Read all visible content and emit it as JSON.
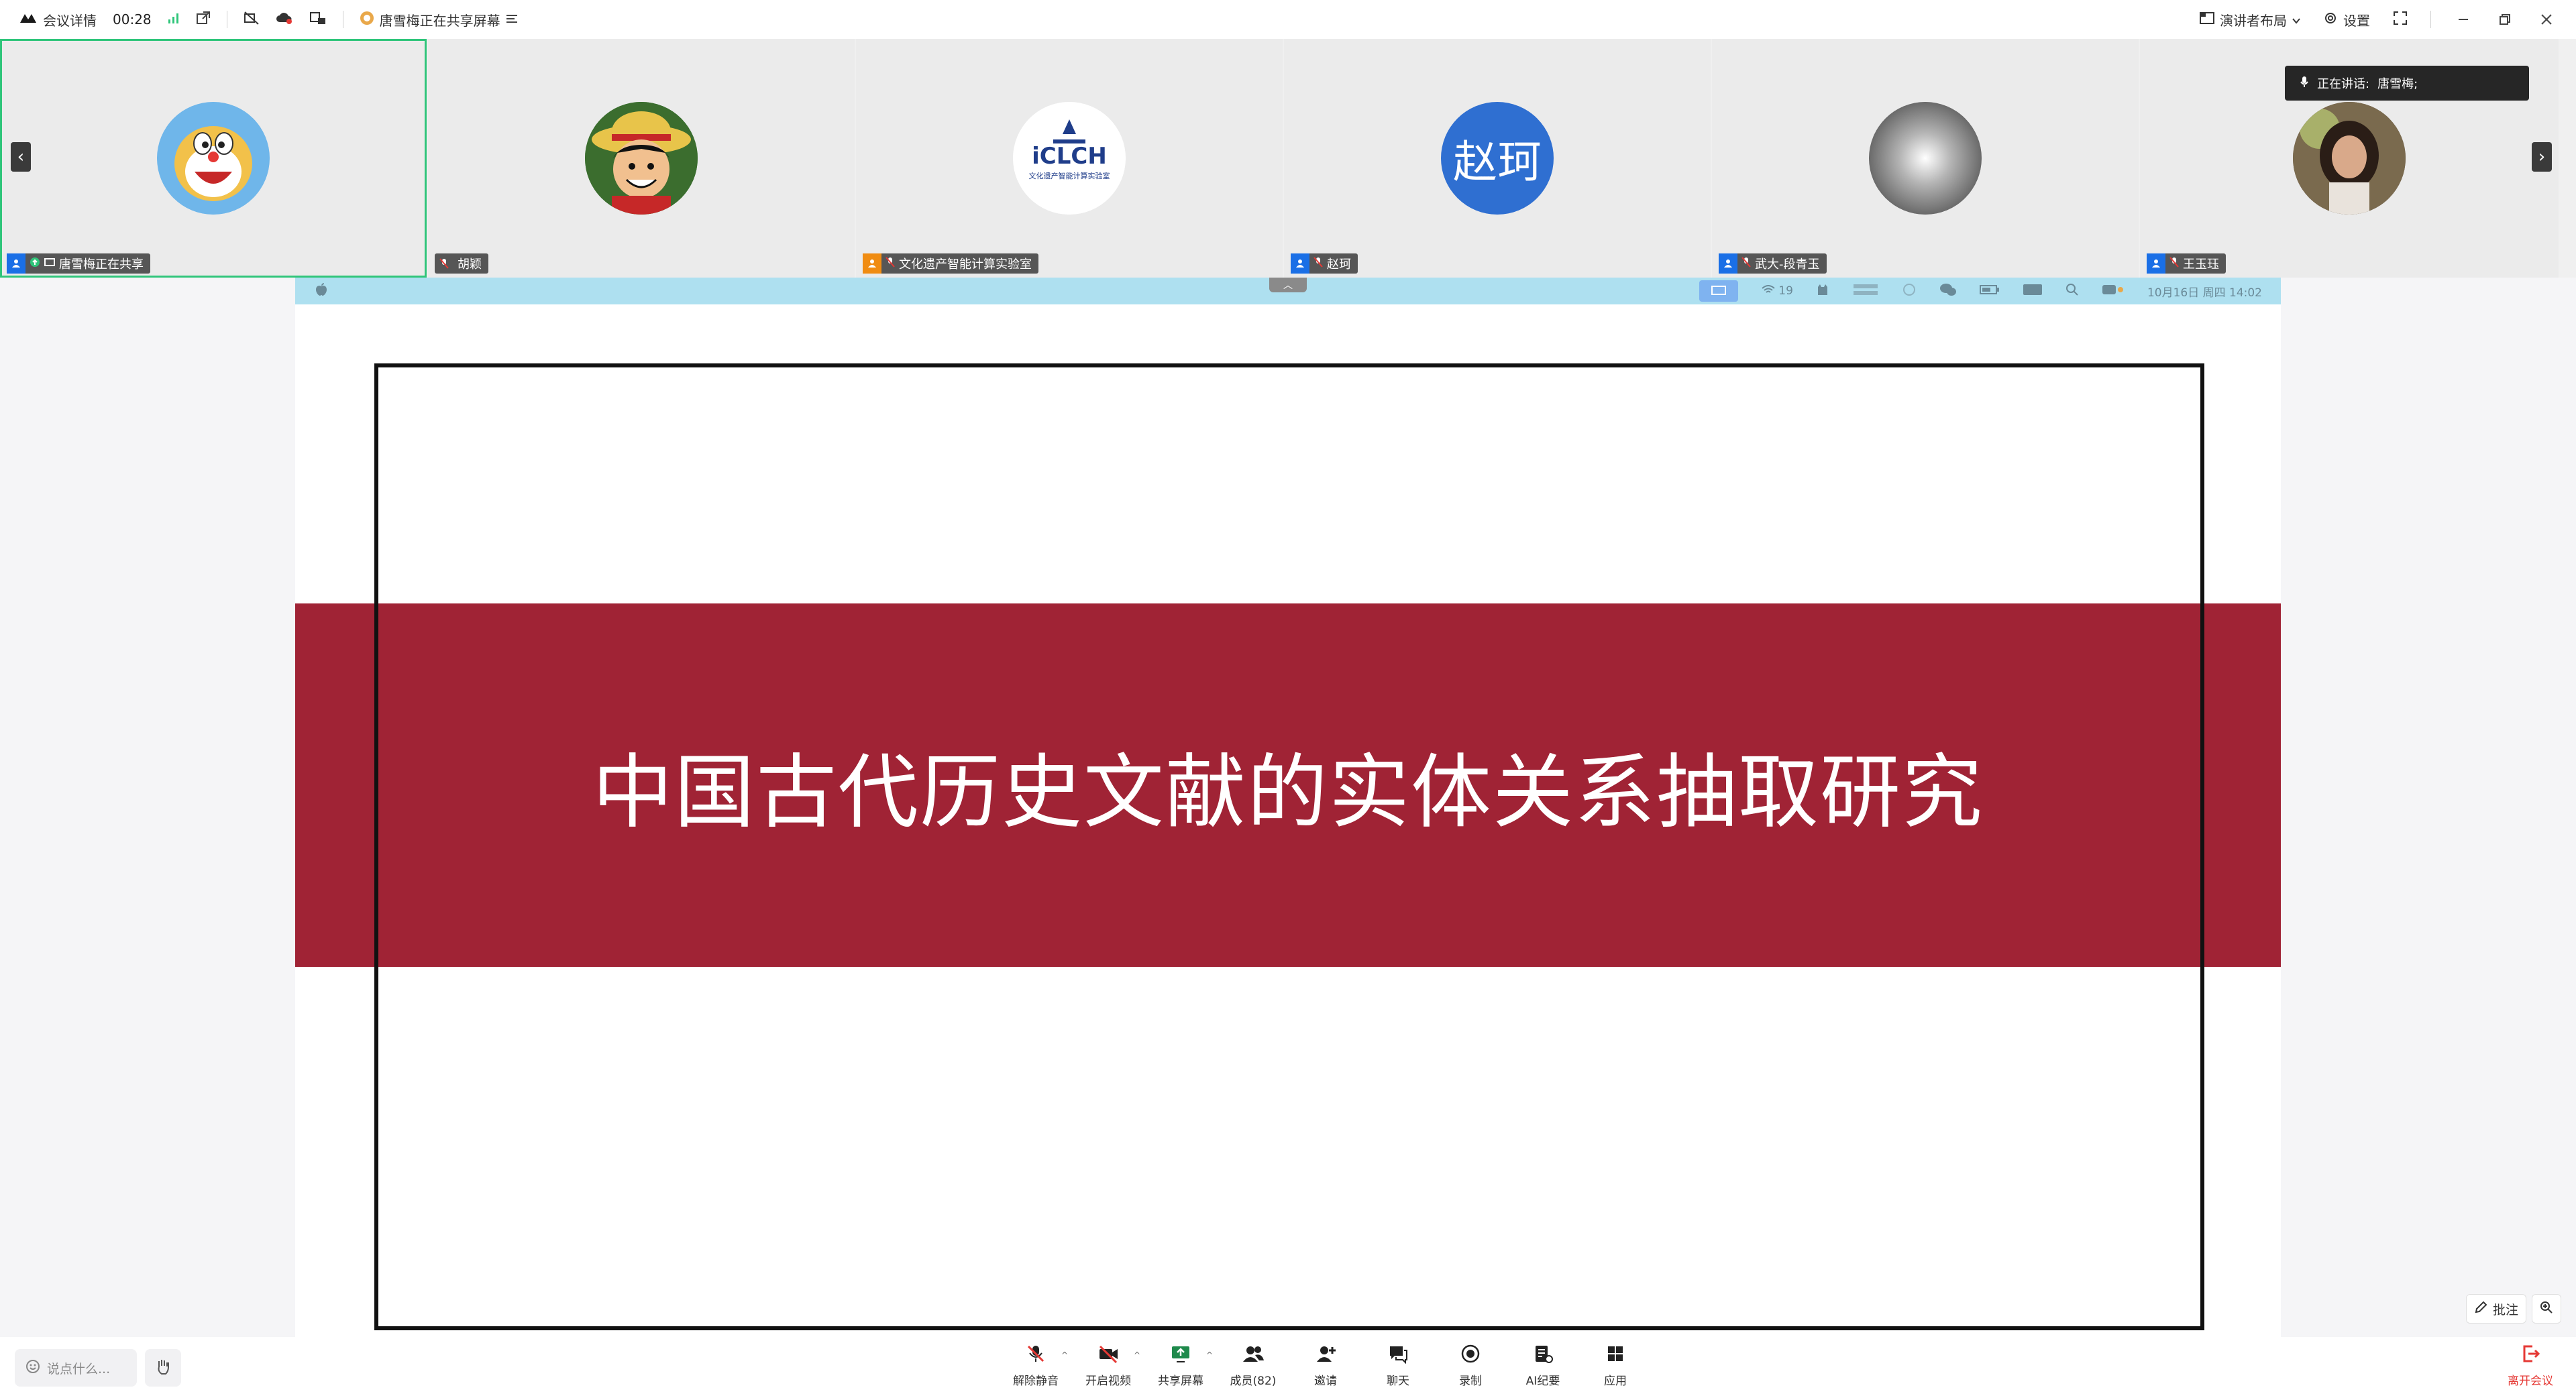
{
  "topbar": {
    "meeting_details": "会议详情",
    "duration": "00:28",
    "sharing_status": "唐雪梅正在共享屏幕",
    "presenter_layout": "演讲者布局",
    "settings": "设置"
  },
  "participants": [
    {
      "name": "唐雪梅正在共享",
      "avatar": "doraemon"
    },
    {
      "name": "胡颖",
      "avatar": "luffy"
    },
    {
      "name": "文化遗产智能计算实验室",
      "avatar": "iclch-logo",
      "logo_text": "iCLCH",
      "logo_sub": "文化遗产智能计算实验室"
    },
    {
      "name": "赵珂",
      "avatar": "text",
      "avatar_text": "赵珂"
    },
    {
      "name": "武大-段青玉",
      "avatar": "sky"
    },
    {
      "name": "王玉珏",
      "avatar": "photo"
    }
  ],
  "speaking": {
    "label": "正在讲话:",
    "name": "唐雪梅;"
  },
  "shared_screen": {
    "menubar": {
      "wifi_count": "19",
      "datetime": "10月16日 周四  14:02"
    },
    "slide_title": "中国古代历史文献的实体关系抽取研究"
  },
  "side": {
    "annotate": "批注"
  },
  "toolbar": {
    "chat_placeholder": "说点什么...",
    "items": [
      {
        "label": "解除静音"
      },
      {
        "label": "开启视频"
      },
      {
        "label": "共享屏幕"
      },
      {
        "label": "成员(82)"
      },
      {
        "label": "邀请"
      },
      {
        "label": "聊天"
      },
      {
        "label": "录制"
      },
      {
        "label": "AI纪要"
      },
      {
        "label": "应用"
      }
    ],
    "leave": "离开会议"
  },
  "colors": {
    "accent_green": "#2fc57a",
    "slide_red": "#a02335",
    "menubar_blue": "#aee0f0",
    "leave_red": "#e53935",
    "blue": "#1a6fe6"
  }
}
